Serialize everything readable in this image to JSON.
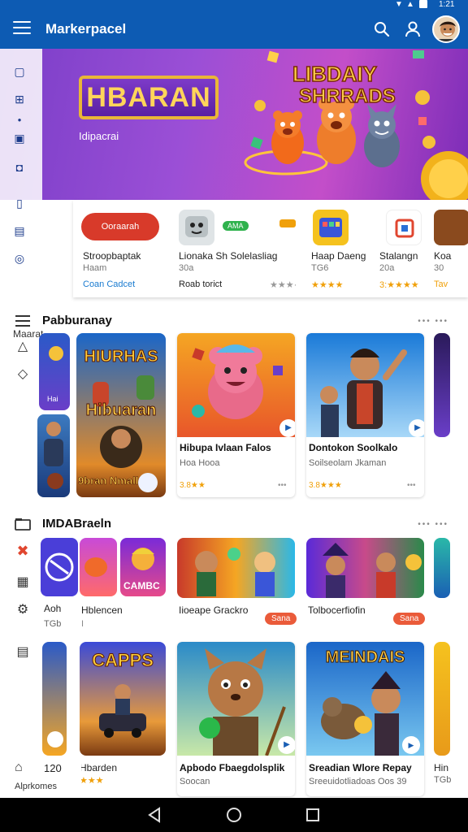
{
  "app": {
    "title": "Markerpacel"
  },
  "banner": {
    "logo_text": "HBARAN",
    "subtitle": "Idipacrai",
    "art_text": "LIBDAIY SHRRADS"
  },
  "rail": {
    "label": "Maarat"
  },
  "featured": [
    {
      "logo_text": "Ooraarah",
      "title": "Stroopbaptak",
      "sub": "Haam",
      "meta": "Coan Cadcet",
      "meta_kind": "link"
    },
    {
      "badge": "AMA",
      "title": "Lionaka Sh Solelasliag",
      "sub": "30a",
      "meta": "Roab torict",
      "stars": "★★★·",
      "meta_kind": "plain"
    },
    {
      "title": "Haap Daeng",
      "sub": "TG6",
      "stars": "★★★★",
      "meta_kind": "stars"
    },
    {
      "title": "Stalangn",
      "sub": "20a",
      "stars": "3:★★★★",
      "meta_kind": "stars"
    },
    {
      "title": "Koa",
      "sub": "30",
      "meta": "Tav",
      "meta_kind": "plain"
    }
  ],
  "section1": {
    "title": "Pabburanay",
    "more": "••• •••"
  },
  "section1_cards": [
    {
      "title": "Hibupa Ivlaan Falos",
      "sub": "Hoa Hooa",
      "rating": "3.8★★",
      "art": "Hibupa Ivlaan Falos"
    },
    {
      "title": "Dontokon Soolkalo",
      "sub": "Soilseolam Jkaman",
      "rating": "3.8★★★",
      "art": "Dontokon Soolkalo"
    }
  ],
  "poster": {
    "line1": "HIURHAS",
    "line2": "Hibuaran",
    "line3": "9bran Nmall"
  },
  "left_tiles": {
    "tile1_label": "Hai",
    "tile2_label": ""
  },
  "section2": {
    "title": "IMDABraeln",
    "more": "••• •••"
  },
  "section2_items": [
    {
      "title": "Hblencen",
      "sub": "",
      "art": "CAMBC"
    },
    {
      "title": "Iioeape Grackro",
      "pill": "Sana"
    },
    {
      "title": "Tolbocerfiofin",
      "pill": "Sana"
    }
  ],
  "side_left": {
    "label1": "Aoh",
    "label2": "TGb"
  },
  "section3_cards": [
    {
      "title": "Hbarden",
      "stars": "★★★",
      "art": "CAPPS"
    },
    {
      "title": "Apbodo Fbaegdolsplik",
      "sub": "Soocan",
      "art": ""
    },
    {
      "title": "Sreadian Wlore Repay",
      "sub": "Sreeuidotliadoas Oos 39",
      "art": "MEINDAIS"
    },
    {
      "title": "Hin",
      "sub": "TGb"
    }
  ],
  "bottom_rail": {
    "label": "Alprkomes",
    "extra": "120"
  },
  "colors": {
    "primary": "#0d5bb3",
    "accent": "#ea5b3a",
    "star": "#f0a00a"
  }
}
